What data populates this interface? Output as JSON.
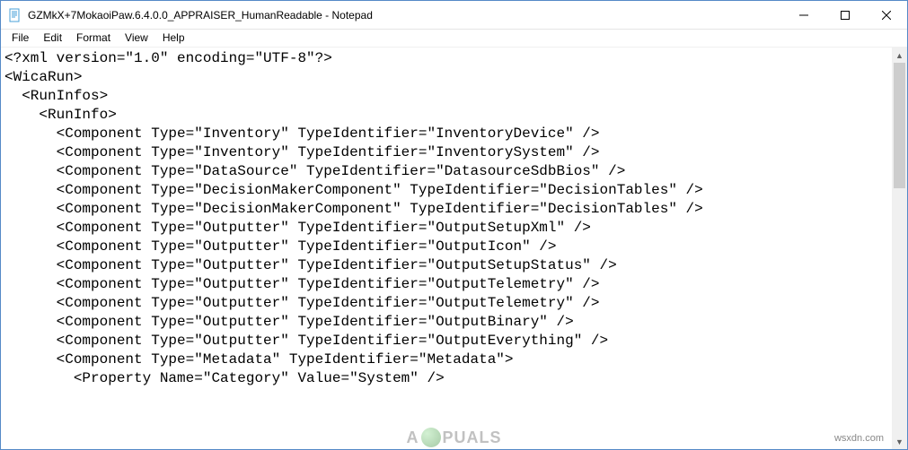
{
  "titlebar": {
    "title": "GZMkX+7MokaoiPaw.6.4.0.0_APPRAISER_HumanReadable - Notepad"
  },
  "menubar": {
    "items": [
      "File",
      "Edit",
      "Format",
      "View",
      "Help"
    ]
  },
  "editor": {
    "lines": [
      "<?xml version=\"1.0\" encoding=\"UTF-8\"?>",
      "<WicaRun>",
      "  <RunInfos>",
      "    <RunInfo>",
      "      <Component Type=\"Inventory\" TypeIdentifier=\"InventoryDevice\" />",
      "      <Component Type=\"Inventory\" TypeIdentifier=\"InventorySystem\" />",
      "      <Component Type=\"DataSource\" TypeIdentifier=\"DatasourceSdbBios\" />",
      "      <Component Type=\"DecisionMakerComponent\" TypeIdentifier=\"DecisionTables\" />",
      "      <Component Type=\"DecisionMakerComponent\" TypeIdentifier=\"DecisionTables\" />",
      "      <Component Type=\"Outputter\" TypeIdentifier=\"OutputSetupXml\" />",
      "      <Component Type=\"Outputter\" TypeIdentifier=\"OutputIcon\" />",
      "      <Component Type=\"Outputter\" TypeIdentifier=\"OutputSetupStatus\" />",
      "      <Component Type=\"Outputter\" TypeIdentifier=\"OutputTelemetry\" />",
      "      <Component Type=\"Outputter\" TypeIdentifier=\"OutputTelemetry\" />",
      "      <Component Type=\"Outputter\" TypeIdentifier=\"OutputBinary\" />",
      "      <Component Type=\"Outputter\" TypeIdentifier=\"OutputEverything\" />",
      "      <Component Type=\"Metadata\" TypeIdentifier=\"Metadata\">",
      "        <Property Name=\"Category\" Value=\"System\" />"
    ]
  },
  "watermarks": {
    "right": "wsxdn.com",
    "center_left": "A",
    "center_right": "PUALS"
  }
}
